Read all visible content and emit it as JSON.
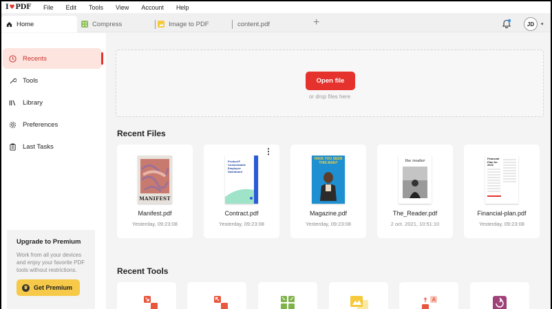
{
  "app": {
    "logo_text_1": "I",
    "logo_text_2": "PDF"
  },
  "menu": [
    "File",
    "Edit",
    "Tools",
    "View",
    "Account",
    "Help"
  ],
  "tabs": [
    {
      "label": "Home",
      "icon": "home-icon"
    },
    {
      "label": "Compress",
      "icon": "compress-icon"
    },
    {
      "label": "Image to PDF",
      "icon": "image-to-pdf-icon"
    },
    {
      "label": "content.pdf",
      "icon": ""
    }
  ],
  "header": {
    "user_initials": "JD"
  },
  "sidebar": {
    "items": [
      {
        "label": "Recents",
        "icon": "clock-icon"
      },
      {
        "label": "Tools",
        "icon": "wrench-icon"
      },
      {
        "label": "Library",
        "icon": "library-icon"
      },
      {
        "label": "Preferences",
        "icon": "gear-icon"
      },
      {
        "label": "Last Tasks",
        "icon": "clipboard-icon"
      }
    ],
    "promo": {
      "title": "Upgrade to Premium",
      "text": "Work from all your devices and enjoy your favorite PDF tools without restrictions.",
      "button": "Get Premium"
    }
  },
  "main": {
    "open_button": "Open file",
    "drop_hint": "or drop files here",
    "recent_files_title": "Recent Files",
    "recent_tools_title": "Recent Tools",
    "files": [
      {
        "name": "Manifest.pdf",
        "date": "Yesterday, 09:23:08",
        "thumb_text": "MANIFEST"
      },
      {
        "name": "Contract.pdf",
        "date": "Yesterday, 09:23:08",
        "thumb_text": "Product® Customizable Employee Dashboard"
      },
      {
        "name": "Magazine.pdf",
        "date": "Yesterday, 09:23:08",
        "thumb_text": "HAVE YOU SEEN THIS MAN?"
      },
      {
        "name": "The_Reader.pdf",
        "date": "2 oct. 2021, 10:51:10",
        "thumb_text": "the reader"
      },
      {
        "name": "Financial-plan.pdf",
        "date": "Yesterday, 09:23:08",
        "thumb_text": "Financial Plan for 2022"
      }
    ],
    "tools": [
      {
        "icon": "merge-pdf-icon"
      },
      {
        "icon": "split-pdf-icon"
      },
      {
        "icon": "compress-pdf-icon"
      },
      {
        "icon": "jpg-to-pdf-icon"
      },
      {
        "icon": "edit-pdf-icon"
      },
      {
        "icon": "rotate-pdf-icon"
      }
    ]
  },
  "colors": {
    "accent": "#e5322d",
    "premium": "#f7c948",
    "active_bg": "#fde4df"
  }
}
